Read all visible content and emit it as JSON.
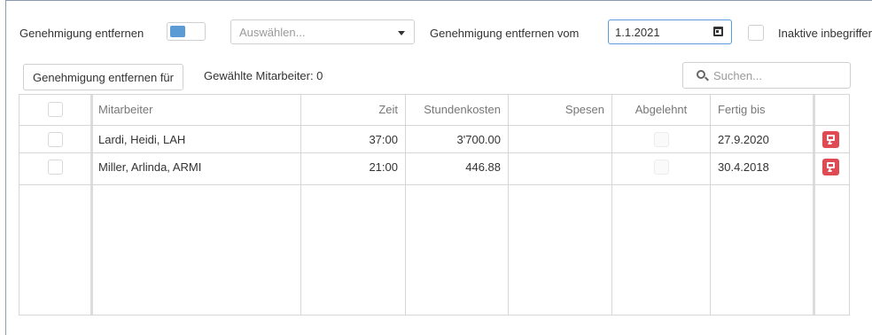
{
  "toolbar": {
    "remove_approval_label": "Genehmigung entfernen",
    "select_placeholder": "Auswählen...",
    "remove_from_label": "Genehmigung entfernen vom",
    "date_value": "1.1.2021",
    "inactive_label": "Inaktive inbegriffen",
    "remove_for_button": "Genehmigung entfernen für",
    "selected_employees": "Gewählte Mitarbeiter: 0",
    "search_placeholder": "Suchen..."
  },
  "table": {
    "columns": [
      "Mitarbeiter",
      "Zeit",
      "Stundenkosten",
      "Spesen",
      "Abgelehnt",
      "Fertig bis"
    ],
    "rows": [
      {
        "employee": "Lardi, Heidi, LAH",
        "time": "37:00",
        "hour_costs": "3'700.00",
        "expenses": "",
        "rejected": false,
        "done_until": "27.9.2020"
      },
      {
        "employee": "Miller, Arlinda, ARMI",
        "time": "21:00",
        "hour_costs": "446.88",
        "expenses": "",
        "rejected": false,
        "done_until": "30.4.2018"
      }
    ]
  },
  "colors": {
    "toggle_knob": "#5b9bd5",
    "date_border": "#5b9bd5",
    "reject_button": "#e04a52"
  },
  "icons": {
    "dropdown": "chevron-down-icon",
    "calendar": "calendar-icon",
    "search": "search-icon",
    "reject": "thumbs-down-icon"
  }
}
